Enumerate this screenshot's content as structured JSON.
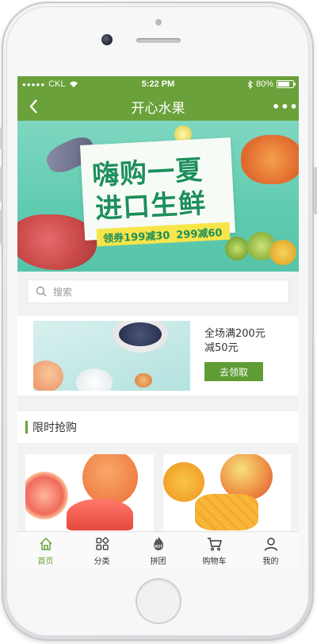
{
  "status_bar": {
    "carrier": "CKL",
    "time": "5:22 PM",
    "battery": "80%",
    "battery_level": 0.8
  },
  "nav": {
    "title": "开心水果",
    "back_icon": "chevron-left-icon",
    "more_icon": "more-dots-icon",
    "more_label": "•••"
  },
  "banner": {
    "headline_line1": "嗨购一夏",
    "headline_line2": "进口生鲜",
    "coupon_1": "领券199减30",
    "coupon_2": "299减60"
  },
  "search": {
    "placeholder": "搜索",
    "icon": "search-icon"
  },
  "promo": {
    "line1": "全场满200元",
    "line2": "减50元",
    "button": "去领取"
  },
  "flash_sale": {
    "title": "限时抢购"
  },
  "tabbar": {
    "items": [
      {
        "label": "首页",
        "icon": "home-icon",
        "active": true
      },
      {
        "label": "分类",
        "icon": "category-grid-icon",
        "active": false
      },
      {
        "label": "拼团",
        "icon": "hot-fire-icon",
        "active": false,
        "badge": "HOT"
      },
      {
        "label": "购物车",
        "icon": "cart-icon",
        "active": false
      },
      {
        "label": "我的",
        "icon": "user-icon",
        "active": false
      }
    ]
  },
  "colors": {
    "brand_green": "#6aa13a",
    "button_green": "#5f9c35",
    "banner_teal": "#5fcbb0"
  }
}
